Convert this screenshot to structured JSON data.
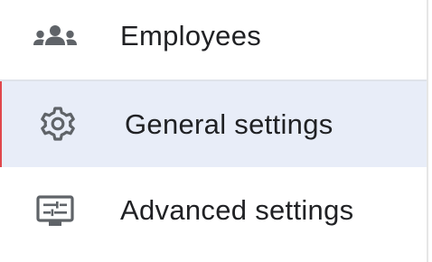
{
  "nav": {
    "items": [
      {
        "label": "Employees",
        "icon": "people-icon",
        "active": false
      },
      {
        "label": "General settings",
        "icon": "gear-icon",
        "active": true
      },
      {
        "label": "Advanced settings",
        "icon": "settings-panel-icon",
        "active": false
      }
    ]
  },
  "colors": {
    "text": "#202124",
    "icon": "#5f6368",
    "active_bg": "#e8edf8",
    "active_indicator": "#e0474c",
    "divider": "#dfe3ea"
  }
}
